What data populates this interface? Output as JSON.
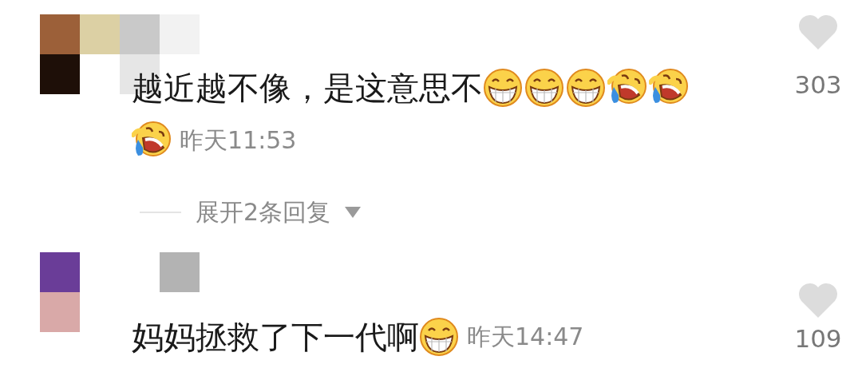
{
  "comments": [
    {
      "text": "越近越不像，是这意思不",
      "emojis": [
        {
          "kind": "grin"
        },
        {
          "kind": "grin"
        },
        {
          "kind": "grin"
        },
        {
          "kind": "rofl"
        },
        {
          "kind": "rofl"
        },
        {
          "kind": "rofl"
        }
      ],
      "time": "昨天11:53",
      "likes": "303",
      "replies": "展开2条回复"
    },
    {
      "text": "妈妈拯救了下一代啊",
      "emojis": [
        {
          "kind": "grin"
        }
      ],
      "time": "昨天14:47",
      "likes": "109"
    }
  ]
}
